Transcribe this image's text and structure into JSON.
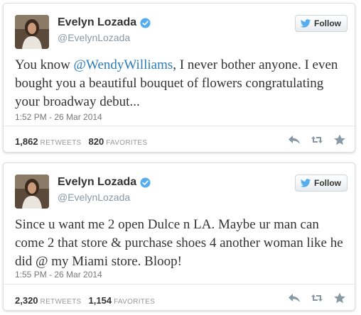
{
  "tweets": [
    {
      "name": "Evelyn Lozada",
      "handle": "@EvelynLozada",
      "follow_label": "Follow",
      "text_before": "You know ",
      "mention": "@WendyWilliams",
      "text_after": ", I never bother anyone. I even bought you a beautiful bouquet of flowers congratulating your broadway debut...",
      "timestamp": "1:52 PM - 26 Mar 2014",
      "retweets_count": "1,862",
      "retweets_label": "RETWEETS",
      "favorites_count": "820",
      "favorites_label": "FAVORITES"
    },
    {
      "name": "Evelyn Lozada",
      "handle": "@EvelynLozada",
      "follow_label": "Follow",
      "text": "Since u want me 2 open Dulce n LA. Maybe ur man can come 2 that store & purchase shoes 4 another woman like he did @ my Miami store. Bloop!",
      "timestamp": "1:55 PM - 26 Mar 2014",
      "retweets_count": "2,320",
      "retweets_label": "RETWEETS",
      "favorites_count": "1,154",
      "favorites_label": "FAVORITES"
    }
  ],
  "colors": {
    "link": "#2b7bb9",
    "verified": "#55acee",
    "twitter_bird": "#55acee",
    "action_icons": "#aab8c2"
  },
  "icons": [
    "verified-badge-icon",
    "twitter-bird-icon",
    "reply-icon",
    "retweet-icon",
    "favorite-star-icon"
  ]
}
